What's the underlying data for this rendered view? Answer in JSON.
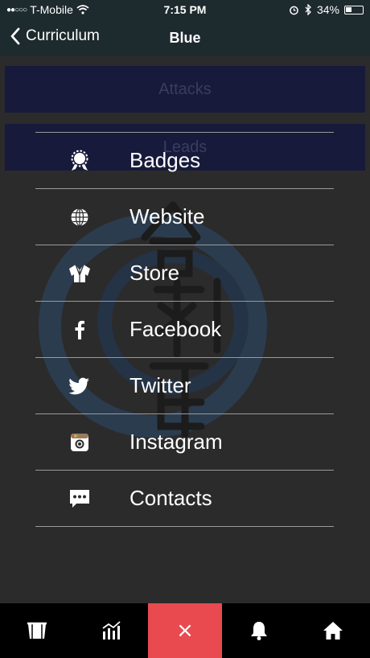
{
  "status": {
    "carrier": "T-Mobile",
    "signal": "●●○○○",
    "time": "7:15 PM",
    "battery": "34%"
  },
  "nav": {
    "back_label": "Curriculum",
    "title": "Blue"
  },
  "curriculum_items": [
    "Attacks",
    "Leads"
  ],
  "menu": [
    {
      "label": "Badges",
      "icon": "badge-icon"
    },
    {
      "label": "Website",
      "icon": "globe-icon"
    },
    {
      "label": "Store",
      "icon": "gi-uniform-icon"
    },
    {
      "label": "Facebook",
      "icon": "facebook-icon"
    },
    {
      "label": "Twitter",
      "icon": "twitter-icon"
    },
    {
      "label": "Instagram",
      "icon": "instagram-icon"
    },
    {
      "label": "Contacts",
      "icon": "chat-bubble-icon"
    }
  ],
  "tab_bar": {
    "tabs": [
      {
        "icon": "curriculum-icon"
      },
      {
        "icon": "progress-chart-icon"
      },
      {
        "icon": "close-icon",
        "label": "×",
        "active": true
      },
      {
        "icon": "bell-icon"
      },
      {
        "icon": "home-icon"
      }
    ],
    "active_color": "#e84a4f"
  },
  "colors": {
    "bar_bg": "#1d2a2e",
    "content_bg": "#2b2b2b",
    "item_bg": "#171a3a"
  }
}
